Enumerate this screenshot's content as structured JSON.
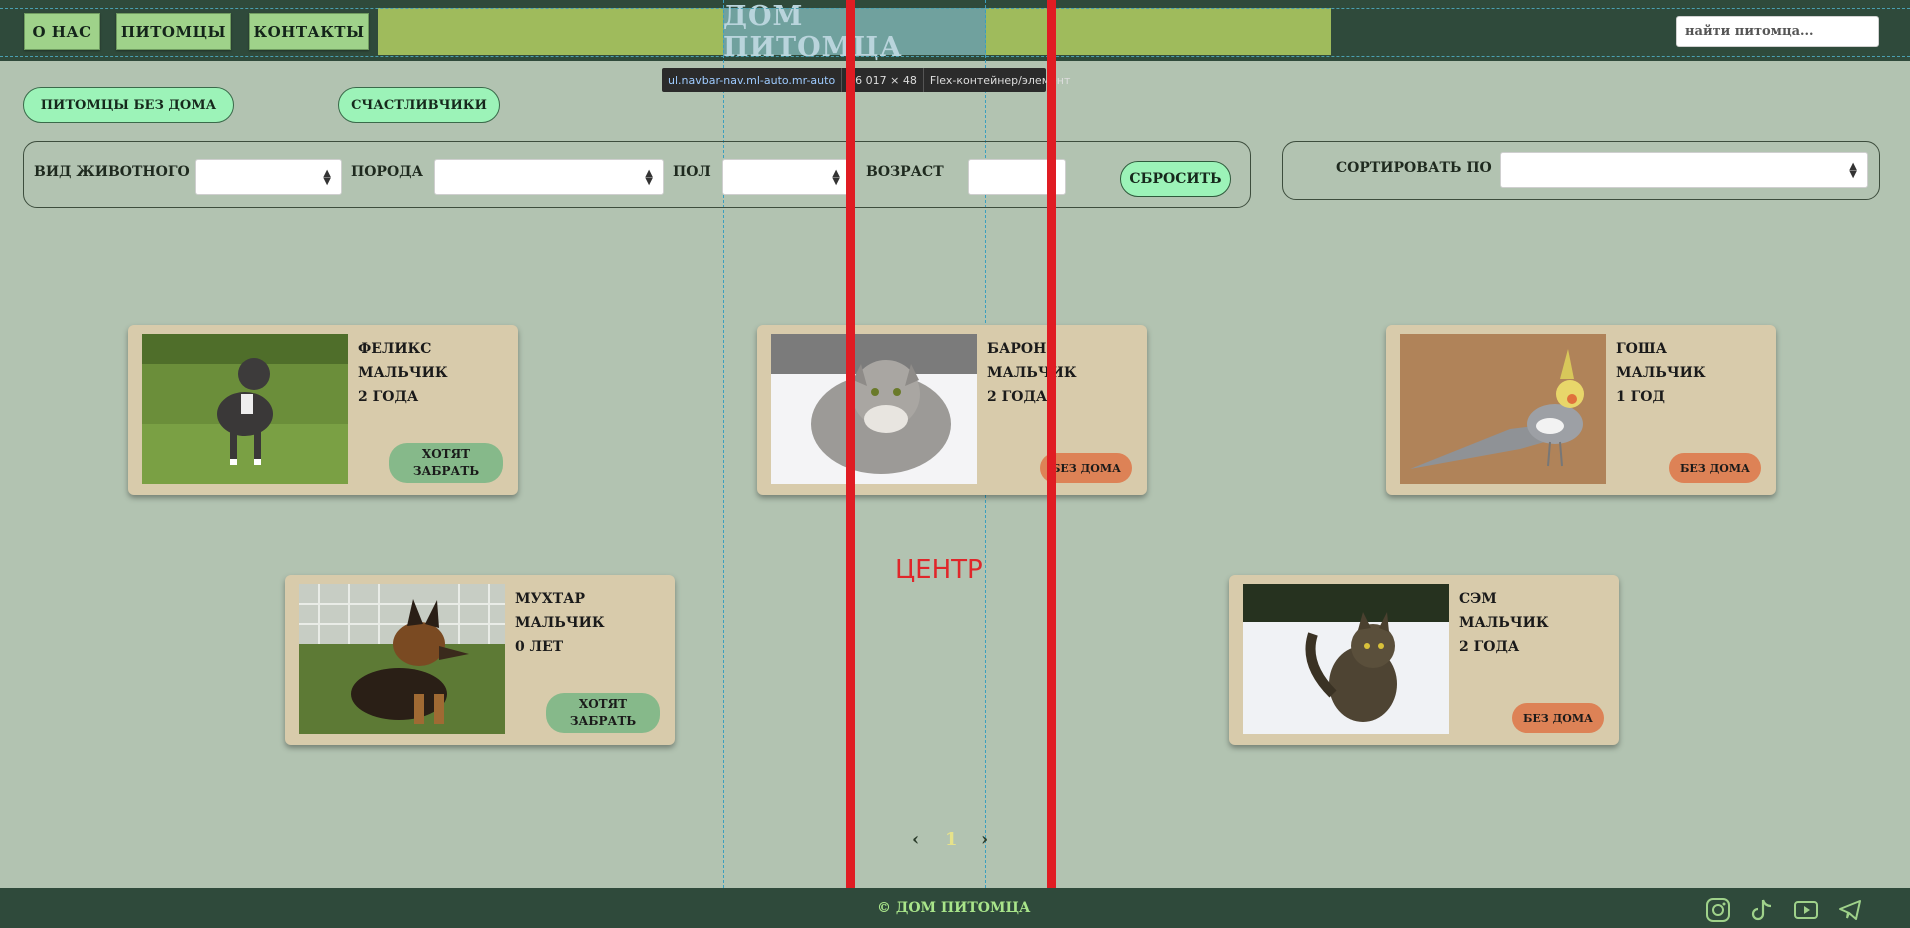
{
  "nav": {
    "items": [
      {
        "label": "о нас"
      },
      {
        "label": "питомцы"
      },
      {
        "label": "контакты"
      }
    ],
    "brand": "дом питомца",
    "search_placeholder": "найти питомца..."
  },
  "devtools": {
    "selector": "ul.navbar-nav.ml-auto.mr-auto",
    "size": "26  017 × 48",
    "type": "Flex-контейнер/элемент"
  },
  "tabs": [
    {
      "label": "питомцы без дома"
    },
    {
      "label": "счастливчики"
    }
  ],
  "filters": {
    "species_label": "вид животного",
    "breed_label": "порода",
    "sex_label": "пол",
    "age_label": "возраст",
    "reset_label": "сбросить"
  },
  "sort": {
    "label": "сортировать по"
  },
  "cards": [
    {
      "name": "феликс",
      "sex": "мальчик",
      "age": "2 года",
      "status": "хотят забрать",
      "photo": "dog-pitbull"
    },
    {
      "name": "барон",
      "sex": "мальчик",
      "age": "2 года",
      "status": "без дома",
      "photo": "cat-fluffy-grey"
    },
    {
      "name": "гоша",
      "sex": "мальчик",
      "age": "1 год",
      "status": "без дома",
      "photo": "parrot-cockatiel"
    },
    {
      "name": "мухтар",
      "sex": "мальчик",
      "age": "0 лет",
      "status": "хотят забрать",
      "photo": "puppy-shepherd"
    },
    {
      "name": "сэм",
      "sex": "мальчик",
      "age": "2 года",
      "status": "без дома",
      "photo": "cat-tabby-snow"
    }
  ],
  "center_annotation": "ЦЕНТР",
  "pagination": {
    "prev": "‹",
    "current": "1",
    "next": "›"
  },
  "footer": {
    "copyright": "© дом питомца",
    "social_icons": [
      "instagram-icon",
      "tiktok-icon",
      "youtube-icon",
      "telegram-icon"
    ]
  },
  "colors": {
    "background": "#b2c3b1",
    "navbar": "#2f4a3b",
    "accent_green": "#9cf3b8",
    "card": "#d8cbab",
    "status_want": "#86b98a",
    "status_home": "#dd8256"
  }
}
